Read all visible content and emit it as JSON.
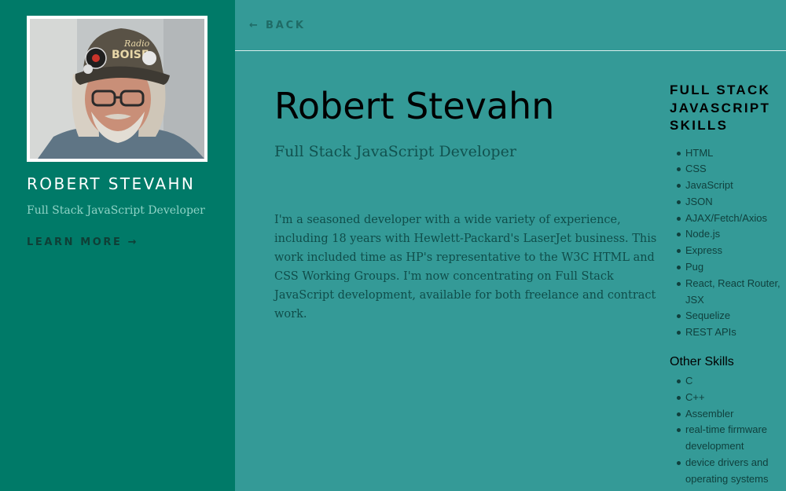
{
  "sidebar": {
    "name": "ROBERT STEVAHN",
    "subtitle": "Full Stack JavaScript Developer",
    "learn_more": "LEARN MORE →"
  },
  "topbar": {
    "back_label": "← BACK"
  },
  "main": {
    "title": "Robert Stevahn",
    "subtitle": "Full Stack JavaScript Developer",
    "bio": "I'm a seasoned developer with a wide variety of experience, including 18 years with Hewlett-Packard's LaserJet business. This work included time as HP's representative to the W3C HTML and CSS Working Groups. I'm now concentrating on Full Stack JavaScript development, available for both freelance and contract work."
  },
  "skills": {
    "heading": "FULL STACK JAVASCRIPT SKILLS",
    "tech": [
      "HTML",
      "CSS",
      "JavaScript",
      "JSON",
      "AJAX/Fetch/Axios",
      "Node.js",
      "Express",
      "Pug",
      "React, React Router, JSX",
      "Sequelize",
      "REST APIs"
    ],
    "other_heading": "Other Skills",
    "other": [
      "C",
      "C++",
      "Assembler",
      "real-time firmware development",
      "device drivers and operating systems"
    ]
  },
  "colors": {
    "sidebar_bg": "#007a68",
    "main_bg": "#349a97",
    "accent_text": "#8fd3c6"
  }
}
